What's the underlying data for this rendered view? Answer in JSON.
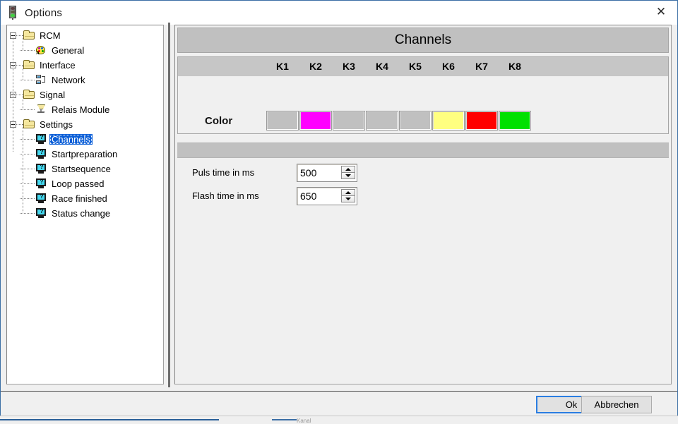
{
  "window": {
    "title": "Options",
    "title_icon": "traffic-light-icon",
    "close_icon": "✕"
  },
  "tree": {
    "nodes": [
      {
        "label": "RCM",
        "icon": "folder-icon",
        "level": 1,
        "expander": "minus"
      },
      {
        "label": "General",
        "icon": "palette-icon",
        "level": 2,
        "expander": "none"
      },
      {
        "label": "Interface",
        "icon": "folder-icon",
        "level": 1,
        "expander": "minus"
      },
      {
        "label": "Network",
        "icon": "network-icon",
        "level": 2,
        "expander": "none"
      },
      {
        "label": "Signal",
        "icon": "folder-icon",
        "level": 1,
        "expander": "minus"
      },
      {
        "label": "Relais Module",
        "icon": "relay-icon",
        "level": 2,
        "expander": "none"
      },
      {
        "label": "Settings",
        "icon": "folder-icon",
        "level": 1,
        "expander": "minus"
      },
      {
        "label": "Channels",
        "icon": "question-monitor-icon",
        "level": 2,
        "expander": "none",
        "selected": true
      },
      {
        "label": "Startpreparation",
        "icon": "question-monitor-icon",
        "level": 2,
        "expander": "none"
      },
      {
        "label": "Startsequence",
        "icon": "question-monitor-icon",
        "level": 2,
        "expander": "none"
      },
      {
        "label": "Loop passed",
        "icon": "question-monitor-icon",
        "level": 2,
        "expander": "none"
      },
      {
        "label": "Race finished",
        "icon": "question-monitor-icon",
        "level": 2,
        "expander": "none"
      },
      {
        "label": "Status change",
        "icon": "question-monitor-icon",
        "level": 2,
        "expander": "none"
      }
    ]
  },
  "panel": {
    "header": "Channels",
    "channel_table": {
      "columns": [
        "K1",
        "K2",
        "K3",
        "K4",
        "K5",
        "K6",
        "K7",
        "K8"
      ],
      "row_label": "Color",
      "colors": [
        "#c0c0c0",
        "#ff00ff",
        "#c0c0c0",
        "#c0c0c0",
        "#c0c0c0",
        "#ffff80",
        "#ff0000",
        "#00e000"
      ]
    },
    "fields": [
      {
        "label": "Puls time in ms",
        "value": "500"
      },
      {
        "label": "Flash time in ms",
        "value": "650"
      }
    ]
  },
  "footer": {
    "ok_label": "Ok",
    "cancel_label": "Abbrechen"
  },
  "background": {
    "hint_text": "Kanal"
  }
}
